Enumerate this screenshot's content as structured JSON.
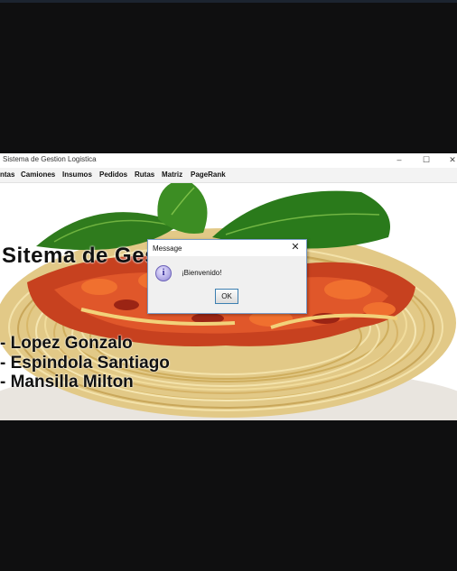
{
  "window": {
    "title": "Sistema de Gestion Logistica",
    "minimize": "–",
    "maximize": "☐",
    "close": "✕"
  },
  "menu": {
    "items": [
      "ntas",
      "Camiones",
      "Insumos",
      "Pedidos",
      "Rutas",
      "Matriz",
      "PageRank"
    ]
  },
  "content": {
    "heading": "Sitema de Gestion Logistica",
    "names": [
      "- Lopez Gonzalo",
      "- Espindola Santiago",
      "- Mansilla Milton"
    ]
  },
  "dialog": {
    "title": "Message",
    "close": "✕",
    "icon": "information-icon",
    "icon_glyph": "i",
    "message": "¡Bienvenido!",
    "ok": "OK"
  }
}
